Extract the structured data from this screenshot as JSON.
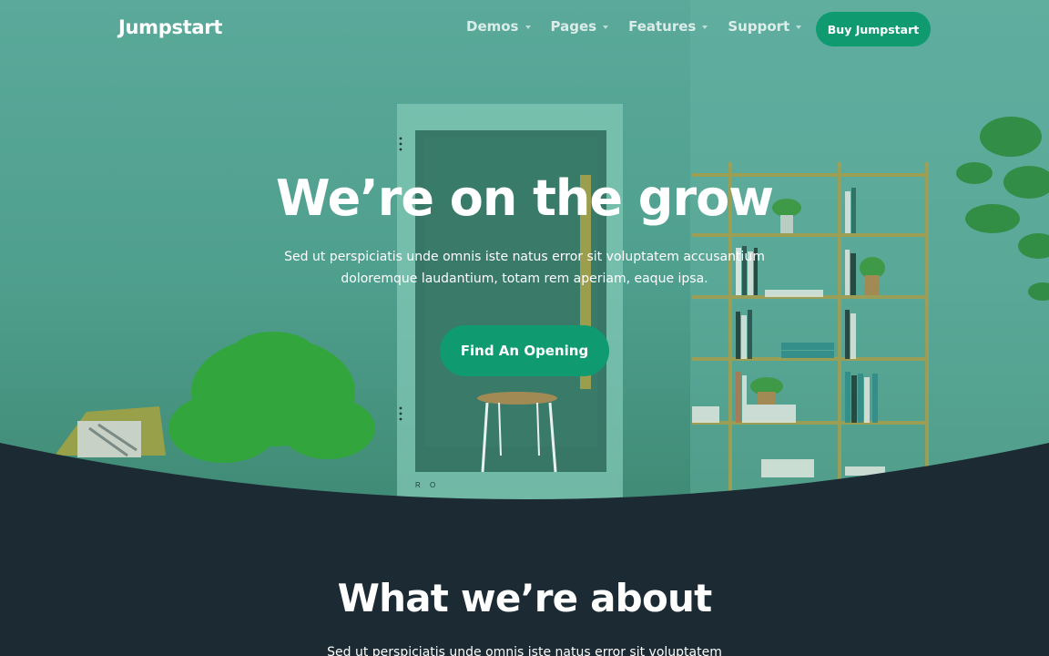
{
  "brand": {
    "logo": "Jumpstart",
    "accent_color": "#0f9a70",
    "overlay_color": "#4f9f8e",
    "dark_color": "#1b2a33"
  },
  "nav": {
    "items": [
      {
        "label": "Demos",
        "icon": "caret-down-icon"
      },
      {
        "label": "Pages",
        "icon": "caret-down-icon"
      },
      {
        "label": "Features",
        "icon": "caret-down-icon"
      },
      {
        "label": "Support",
        "icon": "caret-down-icon"
      }
    ],
    "cta_label": "Buy Jumpstart"
  },
  "hero": {
    "title": "We’re on the grow",
    "subtitle": "Sed ut perspiciatis unde omnis iste natus error sit voluptatem accusantium doloremque laudantium, totam rem aperiam, eaque ipsa.",
    "cta_label": "Find An Opening",
    "booth_text": "R O"
  },
  "about": {
    "title": "What we’re about",
    "subtitle": "Sed ut perspiciatis unde omnis iste natus error sit voluptatem"
  }
}
